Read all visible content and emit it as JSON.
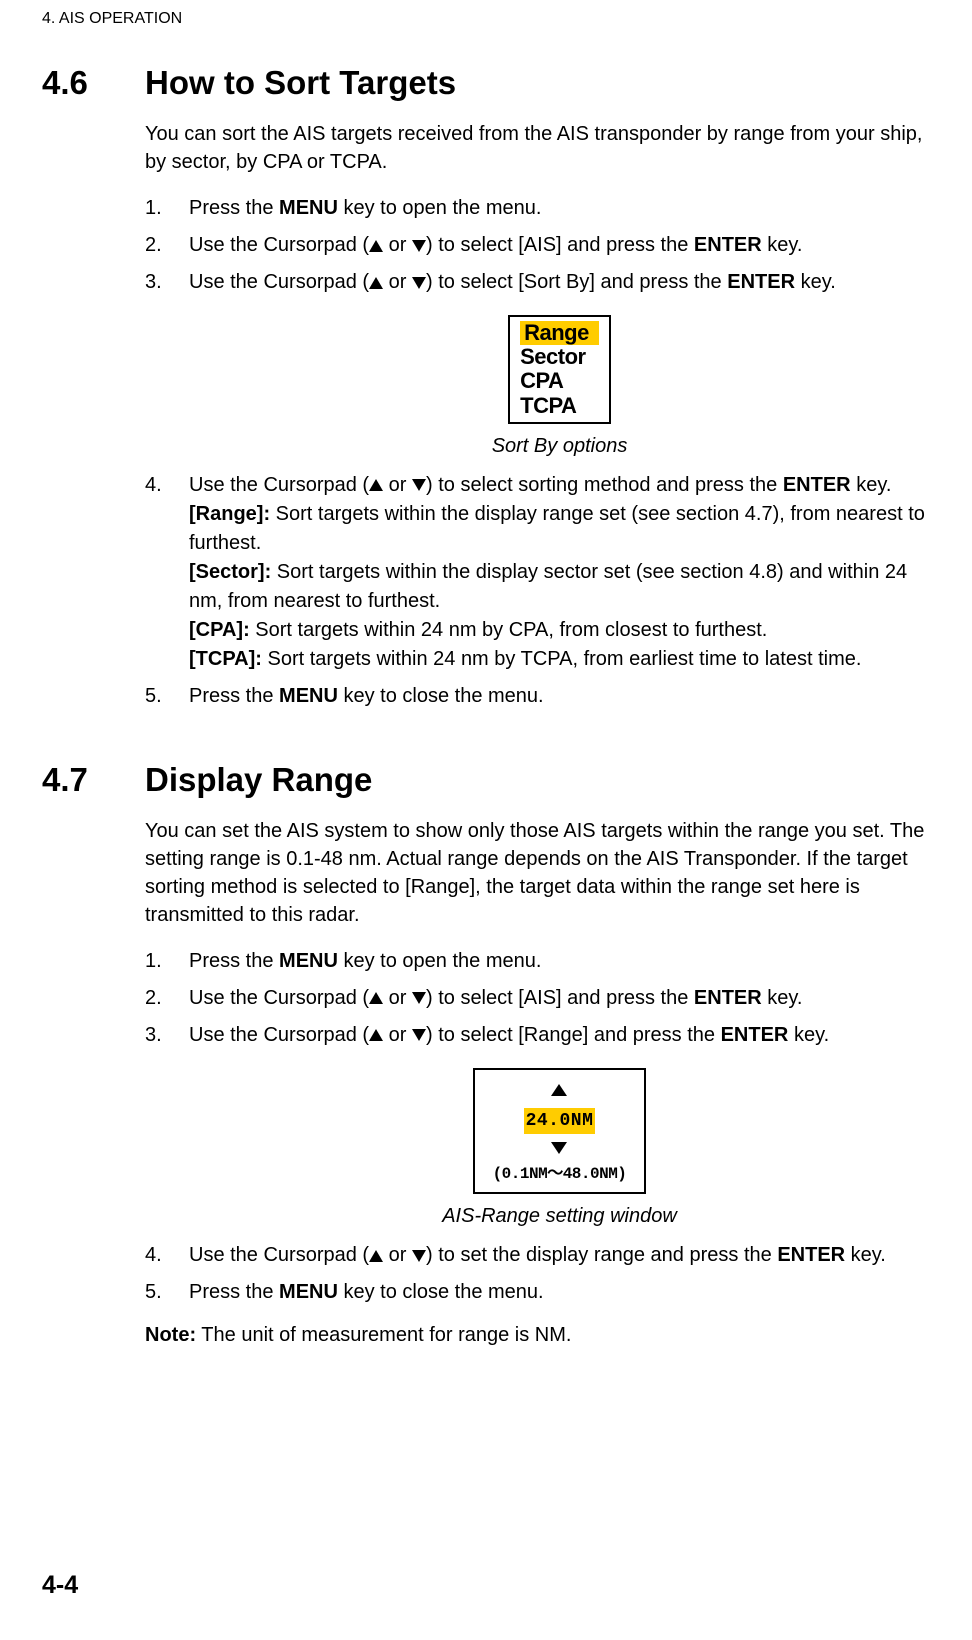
{
  "header": {
    "chapter": "4.  AIS OPERATION"
  },
  "section46": {
    "num": "4.6",
    "title": "How to Sort Targets",
    "intro": "You can sort the AIS targets received from the AIS transponder by range from your ship, by sector, by CPA or TCPA.",
    "steps": {
      "s1_a": "Press the ",
      "s1_b": "MENU",
      "s1_c": " key to open the menu.",
      "s2_a": "Use the Cursorpad (",
      "s2_b": ") to select [AIS] and press the ",
      "s2_c": "ENTER",
      "s2_d": " key.",
      "s3_a": "Use the Cursorpad (",
      "s3_b": ") to select [Sort By] and press the ",
      "s3_c": "ENTER",
      "s3_d": " key.",
      "s4_a": "Use the Cursorpad (",
      "s4_b": ") to select sorting method and press the ",
      "s4_c": "ENTER",
      "s4_d": " key.",
      "s4_r_lbl": "[Range]:",
      "s4_r_txt": " Sort targets within the display range set (see section 4.7), from nearest to furthest.",
      "s4_s_lbl": "[Sector]:",
      "s4_s_txt": " Sort targets within the display sector set (see section 4.8) and within 24 nm, from nearest to furthest.",
      "s4_c_lbl": "[CPA]:",
      "s4_c_txt": " Sort targets within 24 nm by CPA, from closest to furthest.",
      "s4_t_lbl": "[TCPA]:",
      "s4_t_txt": " Sort targets within 24 nm by TCPA, from earliest time to latest time.",
      "s5_a": "Press the ",
      "s5_b": "MENU",
      "s5_c": " key to close the menu."
    },
    "figure": {
      "options": [
        "Range",
        "Sector",
        "CPA",
        "TCPA"
      ],
      "caption": "Sort By options"
    }
  },
  "section47": {
    "num": "4.7",
    "title": "Display Range",
    "intro": "You can set the AIS system to show only those AIS targets within the range you set. The setting range is 0.1-48 nm. Actual range depends on the AIS Transponder. If the target sorting method is selected to [Range], the target data within the range set here is transmitted to this radar.",
    "steps": {
      "s1_a": "Press the ",
      "s1_b": "MENU",
      "s1_c": " key to open the menu.",
      "s2_a": "Use the Cursorpad (",
      "s2_b": ") to select [AIS] and press the ",
      "s2_c": "ENTER",
      "s2_d": " key.",
      "s3_a": "Use the Cursorpad (",
      "s3_b": ") to select [Range] and press the ",
      "s3_c": "ENTER",
      "s3_d": " key.",
      "s4_a": "Use the Cursorpad (",
      "s4_b": ") to set the display range and press the ",
      "s4_c": "ENTER",
      "s4_d": " key.",
      "s5_a": "Press the ",
      "s5_b": "MENU",
      "s5_c": " key to close the menu."
    },
    "figure": {
      "value": "24.0NM",
      "hint": "(0.1NM～48.0NM)",
      "caption": "AIS-Range setting window"
    },
    "note_lbl": "Note:",
    "note_txt": " The unit of measurement for range is NM."
  },
  "or": " or ",
  "page": "4-4"
}
